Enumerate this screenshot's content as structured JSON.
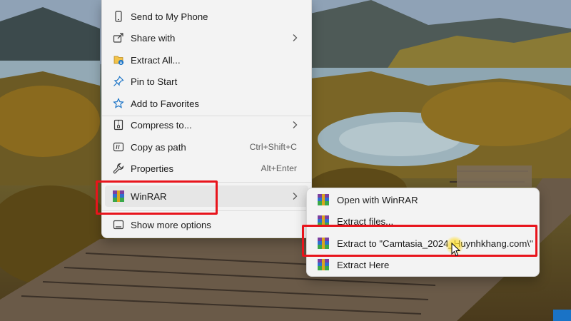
{
  "context_menu": {
    "items": [
      {
        "label": "Send to My Phone",
        "icon": "phone-icon",
        "shortcut": "",
        "submenu": false
      },
      {
        "label": "Share with",
        "icon": "share-icon",
        "shortcut": "",
        "submenu": true
      },
      {
        "label": "Extract All...",
        "icon": "extract-all-icon",
        "shortcut": "",
        "submenu": false
      },
      {
        "label": "Pin to Start",
        "icon": "pin-icon",
        "shortcut": "",
        "submenu": false
      },
      {
        "label": "Add to Favorites",
        "icon": "star-icon",
        "shortcut": "",
        "submenu": false
      },
      {
        "label": "Compress to...",
        "icon": "compress-icon",
        "shortcut": "",
        "submenu": true
      },
      {
        "label": "Copy as path",
        "icon": "copy-path-icon",
        "shortcut": "Ctrl+Shift+C",
        "submenu": false
      },
      {
        "label": "Properties",
        "icon": "wrench-icon",
        "shortcut": "Alt+Enter",
        "submenu": false
      },
      {
        "label": "WinRAR",
        "icon": "winrar-icon",
        "shortcut": "",
        "submenu": true
      },
      {
        "label": "Show more options",
        "icon": "show-more-icon",
        "shortcut": "",
        "submenu": false
      }
    ]
  },
  "winrar_submenu": {
    "items": [
      {
        "label": "Open with WinRAR",
        "icon": "winrar-icon"
      },
      {
        "label": "Extract files...",
        "icon": "winrar-icon"
      },
      {
        "label": "Extract to \"Camtasia_2024_Huynhkhang.com\\\"",
        "icon": "winrar-icon"
      },
      {
        "label": "Extract Here",
        "icon": "winrar-icon"
      }
    ]
  },
  "colors": {
    "highlight": "#e8141c",
    "menu_background": "#f3f3f3",
    "accent_icon": "#1a73c6"
  }
}
